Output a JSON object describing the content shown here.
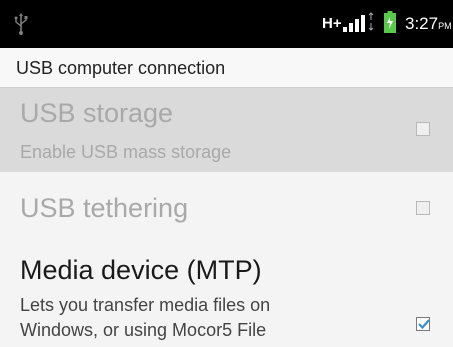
{
  "status_bar": {
    "usb_icon": "usb-icon",
    "network_type": "H+",
    "signal_icon": "signal-icon",
    "battery_icon": "battery-icon",
    "time": "3:27",
    "ampm": "PM"
  },
  "header": {
    "title": "USB computer connection"
  },
  "options": [
    {
      "title": "USB storage",
      "summary": "Enable USB mass storage",
      "checked": false,
      "enabled": false
    },
    {
      "title": "USB tethering",
      "checked": false,
      "enabled": false
    },
    {
      "title": "Media device (MTP)",
      "summary_line1": "Lets you transfer media files on",
      "summary_line2": "Windows, or using Mocor5 File",
      "checked": true,
      "enabled": true
    }
  ],
  "colors": {
    "status_bar_bg": "#000000",
    "disabled_text": "#a9a9a9",
    "selected_row_bg": "#dadada",
    "checkmark": "#3b8fd6"
  }
}
